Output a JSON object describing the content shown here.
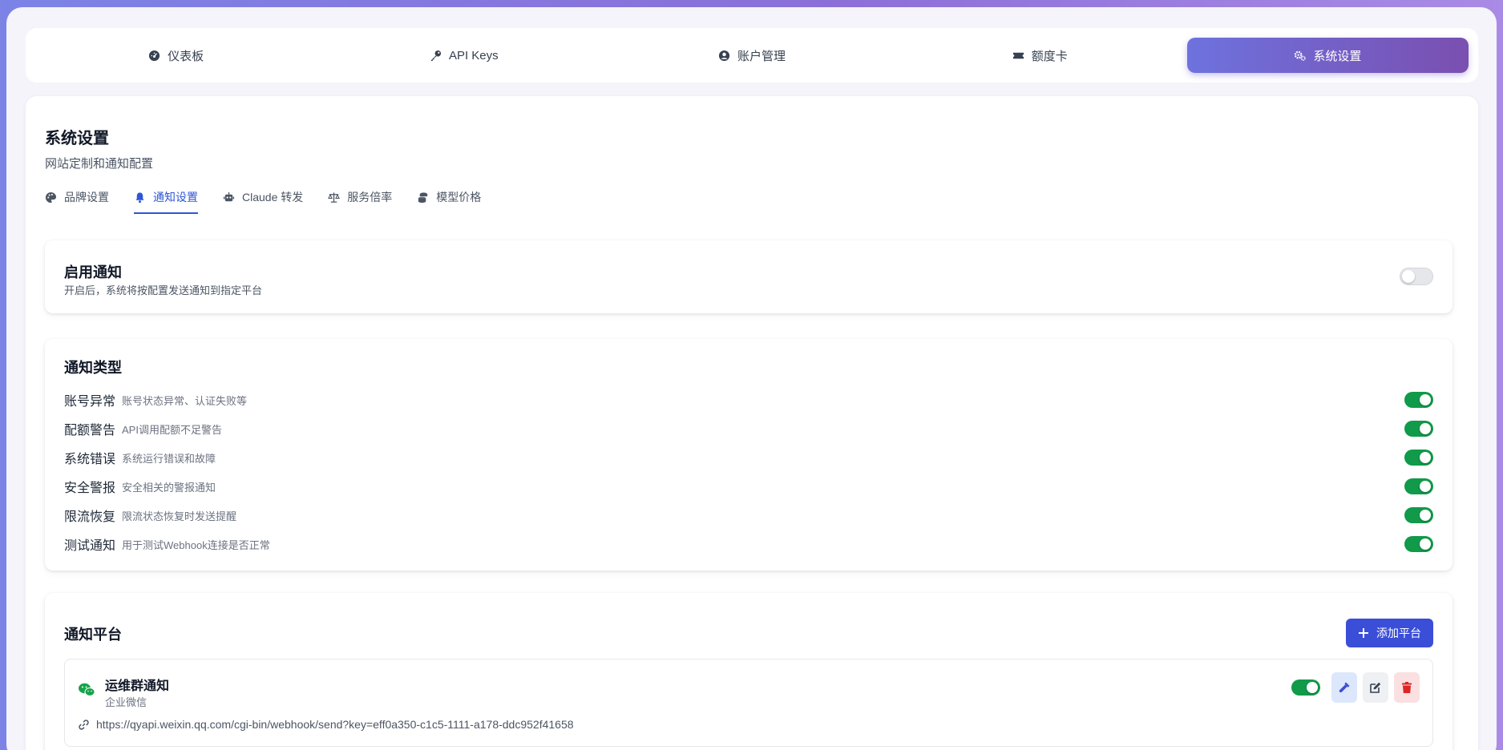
{
  "nav": [
    {
      "label": "仪表板",
      "icon": "dashboard-icon"
    },
    {
      "label": "API Keys",
      "icon": "key-icon"
    },
    {
      "label": "账户管理",
      "icon": "user-circle-icon"
    },
    {
      "label": "额度卡",
      "icon": "ticket-icon"
    },
    {
      "label": "系统设置",
      "icon": "cogs-icon",
      "active": true
    }
  ],
  "page": {
    "title": "系统设置",
    "subtitle": "网站定制和通知配置"
  },
  "tabs": [
    {
      "label": "品牌设置",
      "icon": "palette-icon"
    },
    {
      "label": "通知设置",
      "icon": "bell-icon",
      "active": true
    },
    {
      "label": "Claude 转发",
      "icon": "robot-icon"
    },
    {
      "label": "服务倍率",
      "icon": "scale-icon"
    },
    {
      "label": "模型价格",
      "icon": "coins-icon"
    }
  ],
  "enable": {
    "title": "启用通知",
    "description": "开启后，系统将按配置发送通知到指定平台",
    "enabled": false
  },
  "types": {
    "title": "通知类型",
    "items": [
      {
        "name": "账号异常",
        "desc": "账号状态异常、认证失败等",
        "enabled": true
      },
      {
        "name": "配额警告",
        "desc": "API调用配额不足警告",
        "enabled": true
      },
      {
        "name": "系统错误",
        "desc": "系统运行错误和故障",
        "enabled": true
      },
      {
        "name": "安全警报",
        "desc": "安全相关的警报通知",
        "enabled": true
      },
      {
        "name": "限流恢复",
        "desc": "限流状态恢复时发送提醒",
        "enabled": true
      },
      {
        "name": "测试通知",
        "desc": "用于测试Webhook连接是否正常",
        "enabled": true
      }
    ]
  },
  "platforms": {
    "title": "通知平台",
    "add_label": "添加平台",
    "items": [
      {
        "name": "运维群通知",
        "type": "企业微信",
        "url": "https://qyapi.weixin.qq.com/cgi-bin/webhook/send?key=eff0a350-c1c5-1111-a178-ddc952f41658",
        "enabled": true
      }
    ]
  },
  "colors": {
    "accent": "#3b4ed8",
    "toggle_on": "#109a4a",
    "wechat": "#16a34a",
    "delete": "#dc2626"
  }
}
